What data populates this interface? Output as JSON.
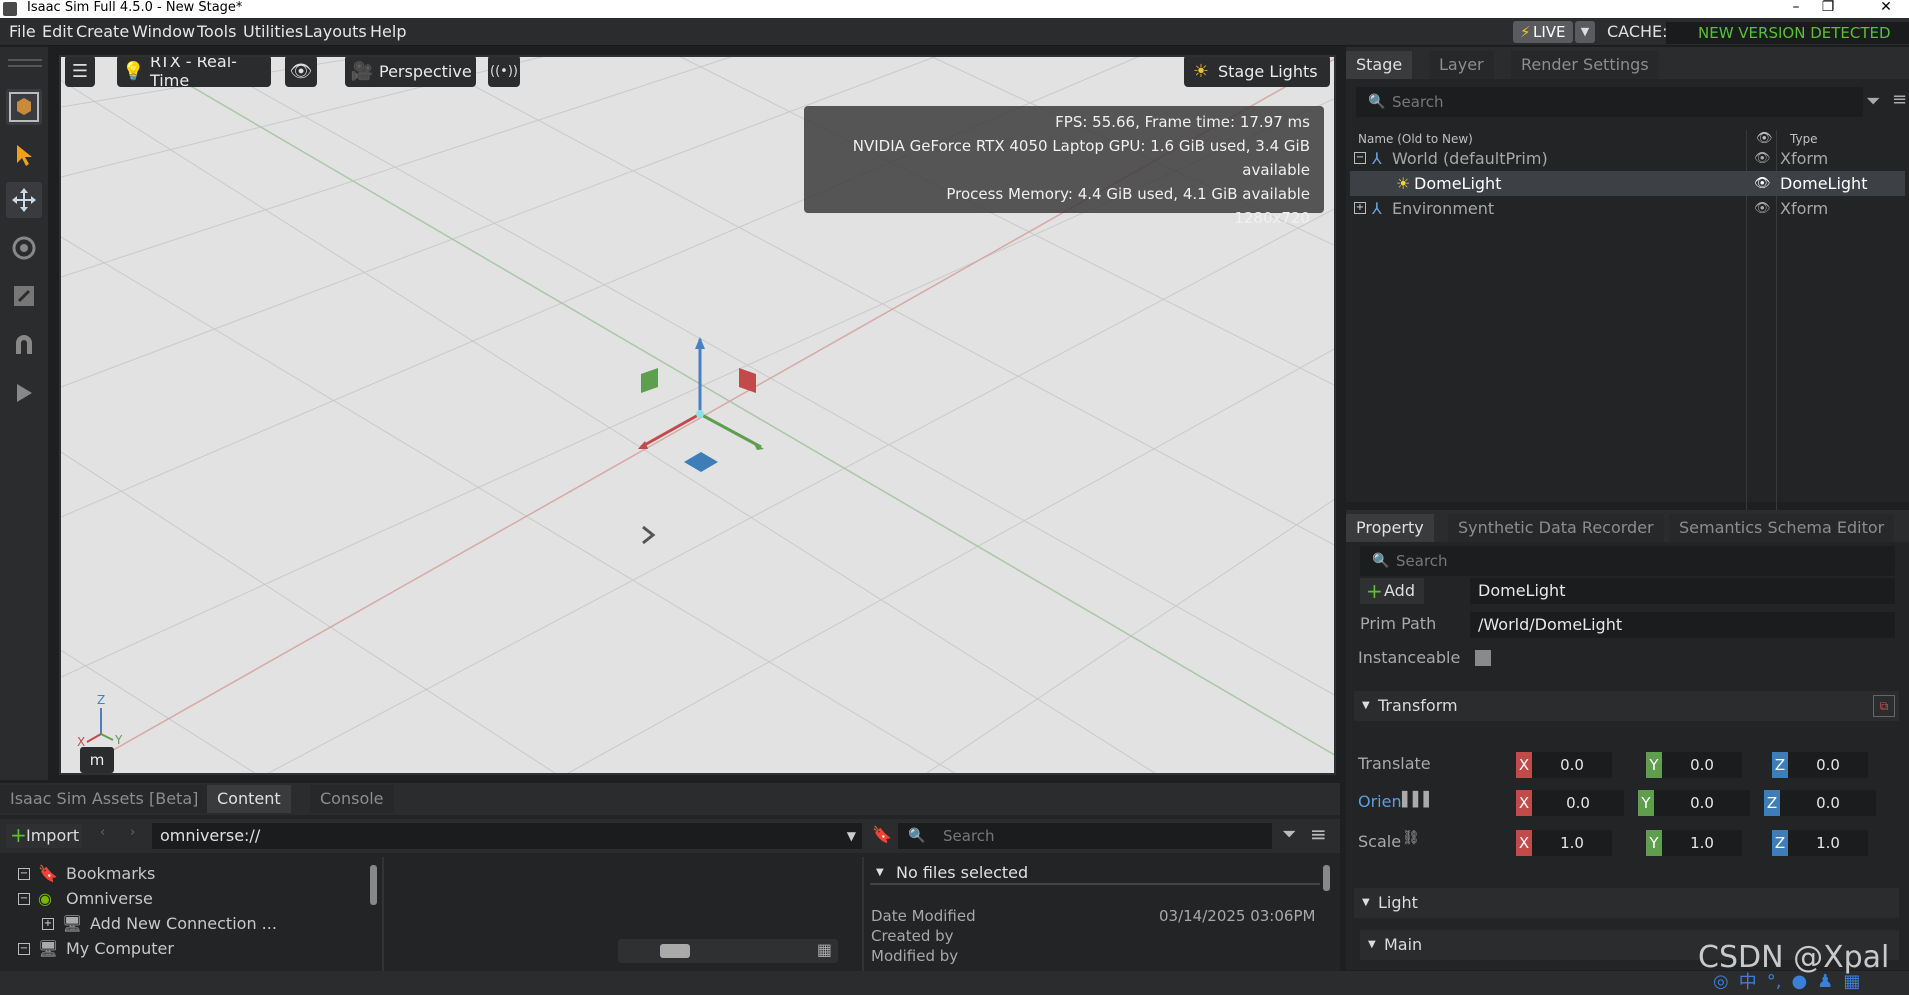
{
  "window": {
    "title": "Isaac Sim Full 4.5.0 - New Stage*",
    "controls": [
      "–",
      "❐",
      "✕"
    ]
  },
  "menu": {
    "items": [
      "File",
      "Edit",
      "Create",
      "Window",
      "Tools",
      "Utilities",
      "Layouts",
      "Help"
    ],
    "live_label": "LIVE",
    "cache_label": "CACHE:",
    "new_version": "NEW VERSION DETECTED"
  },
  "viewport": {
    "renderer": "RTX - Real-Time",
    "camera": "Perspective",
    "lights": "Stage Lights",
    "stats": {
      "fps": "FPS: 55.66, Frame time: 17.97 ms",
      "gpu": "NVIDIA GeForce RTX 4050 Laptop GPU: 1.6 GiB used, 3.4 GiB available",
      "memory": "Process Memory: 4.4 GiB used, 4.1 GiB available",
      "resolution": "1280x720"
    },
    "axis_labels": {
      "x": "X",
      "y": "Y",
      "z": "Z"
    },
    "mode_key": "m"
  },
  "stage": {
    "tabs": [
      "Stage",
      "Layer",
      "Render Settings"
    ],
    "search_placeholder": "Search",
    "columns": {
      "name": "Name (Old to New)",
      "type": "Type"
    },
    "rows": [
      {
        "name": "World (defaultPrim)",
        "type": "Xform",
        "expander": "−"
      },
      {
        "name": "DomeLight",
        "type": "DomeLight",
        "expander": ""
      },
      {
        "name": "Environment",
        "type": "Xform",
        "expander": "+"
      }
    ]
  },
  "property": {
    "tabs": [
      "Property",
      "Synthetic Data Recorder",
      "Semantics Schema Editor"
    ],
    "search_placeholder": "Search",
    "add_label": "Add",
    "prim_name": "DomeLight",
    "prim_path_label": "Prim Path",
    "prim_path": "/World/DomeLight",
    "instanceable_label": "Instanceable",
    "transform_label": "Transform",
    "translate_label": "Translate",
    "orient_label": "Orien",
    "scale_label": "Scale",
    "translate": {
      "x": "0.0",
      "y": "0.0",
      "z": "0.0"
    },
    "orient": {
      "x": "0.0",
      "y": "0.0",
      "z": "0.0"
    },
    "scale": {
      "x": "1.0",
      "y": "1.0",
      "z": "1.0"
    },
    "light_label": "Light",
    "main_label": "Main"
  },
  "content": {
    "tabs": [
      "Isaac Sim Assets [Beta]",
      "Content",
      "Console"
    ],
    "import_label": "Import",
    "path": "omniverse://",
    "search_placeholder": "Search",
    "tree": [
      "Bookmarks",
      "Omniverse",
      "Add New Connection ...",
      "My Computer"
    ],
    "details_header": "No files selected",
    "date_modified_label": "Date Modified",
    "date_modified_value": "03/14/2025 03:06PM",
    "created_by_label": "Created by",
    "modified_by_label": "Modified by"
  },
  "watermark": "CSDN @Xpal"
}
